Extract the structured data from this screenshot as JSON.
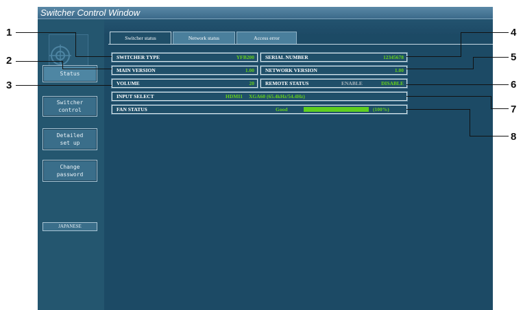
{
  "window": {
    "title": "Switcher Control Window"
  },
  "sidebar": {
    "buttons": [
      {
        "label": "Status"
      },
      {
        "label": "Switcher\ncontrol"
      },
      {
        "label": "Detailed\nset up"
      },
      {
        "label": "Change\npassword"
      }
    ],
    "language_label": "JAPANESE"
  },
  "tabs": [
    {
      "label": "Switcher status"
    },
    {
      "label": "Network status"
    },
    {
      "label": "Access error"
    }
  ],
  "status": {
    "switcher_type": {
      "label": "SWITCHER TYPE",
      "value": "YFB200"
    },
    "serial_number": {
      "label": "SERIAL NUMBER",
      "value": "12345678"
    },
    "main_version": {
      "label": "MAIN VERSION",
      "value": "1.00"
    },
    "network_version": {
      "label": "NETWORK VERSION",
      "value": "1.00"
    },
    "volume": {
      "label": "VOLUME",
      "value": "20"
    },
    "remote_status": {
      "label": "REMOTE STATUS",
      "enable": "ENABLE",
      "disable": "DISABLE"
    },
    "input_select": {
      "label": "INPUT SELECT",
      "input": "HDMI1",
      "signal": "XGA60 (65.4kHz/54.4Hz)"
    },
    "fan_status": {
      "label": "FAN STATUS",
      "state": "Good",
      "percent_label": "(100%)",
      "level": 1.0
    }
  },
  "callouts": [
    "1",
    "2",
    "3",
    "4",
    "5",
    "6",
    "7",
    "8"
  ],
  "colors": {
    "window_bg": "#1d4a66",
    "value_green": "#66d11a",
    "enable_gray": "#a6b3ba"
  }
}
